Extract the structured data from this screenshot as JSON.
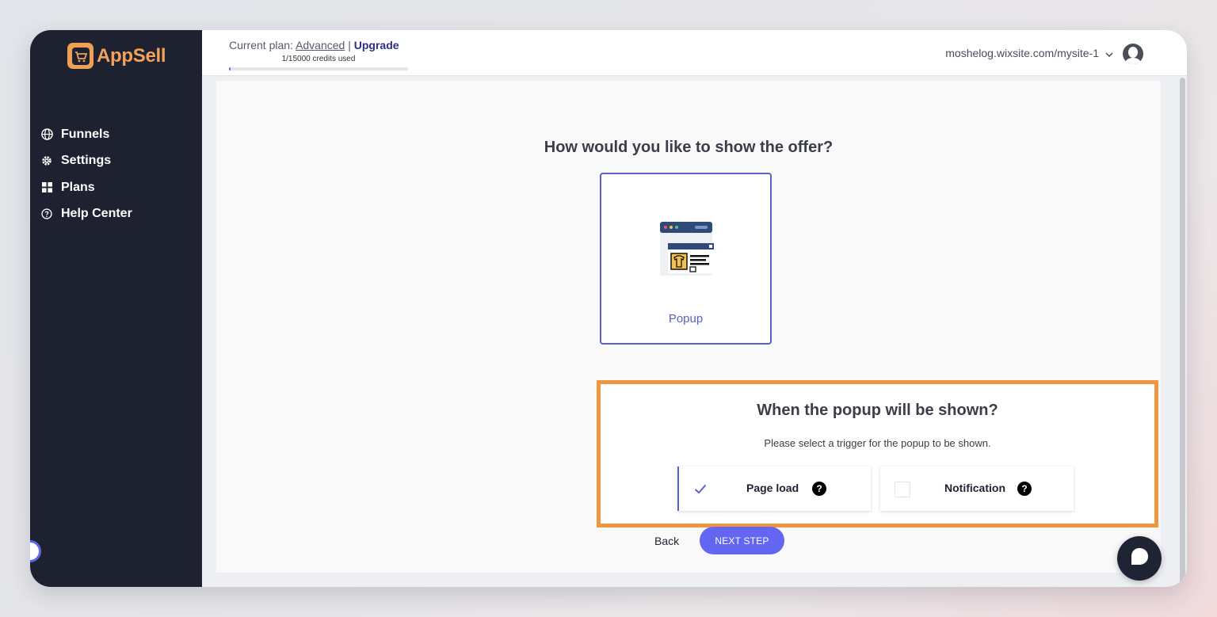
{
  "brand": {
    "name": "AppSell",
    "accent": "#f3a25a",
    "logo_icon": "cart-icon"
  },
  "sidebar": {
    "items": [
      {
        "label": "Funnels",
        "icon": "globe-icon"
      },
      {
        "label": "Settings",
        "icon": "gear-icon"
      },
      {
        "label": "Plans",
        "icon": "grid-icon"
      },
      {
        "label": "Help Center",
        "icon": "question-circle-icon"
      }
    ]
  },
  "topbar": {
    "plan_prefix": "Current plan:",
    "plan_name": "Advanced",
    "separator": "|",
    "upgrade_label": "Upgrade",
    "credits_text": "1/15000 credits used",
    "credits_used": 1,
    "credits_total": 15000,
    "site_url": "moshelog.wixsite.com/mysite-1"
  },
  "main": {
    "question": "How would you like to show the offer?",
    "display_option": {
      "label": "Popup",
      "icon": "popup-window-icon",
      "selected": true
    },
    "trigger": {
      "title": "When the popup will be shown?",
      "subtitle": "Please select a trigger for the popup to be shown.",
      "options": [
        {
          "label": "Page load",
          "checked": true
        },
        {
          "label": "Notification",
          "checked": false
        }
      ],
      "help_glyph": "?"
    },
    "back_label": "Back",
    "next_label": "NEXT STEP"
  },
  "colors": {
    "primary": "#6366f1",
    "highlight_border": "#f0963e",
    "sidebar_bg": "#1d2130"
  }
}
